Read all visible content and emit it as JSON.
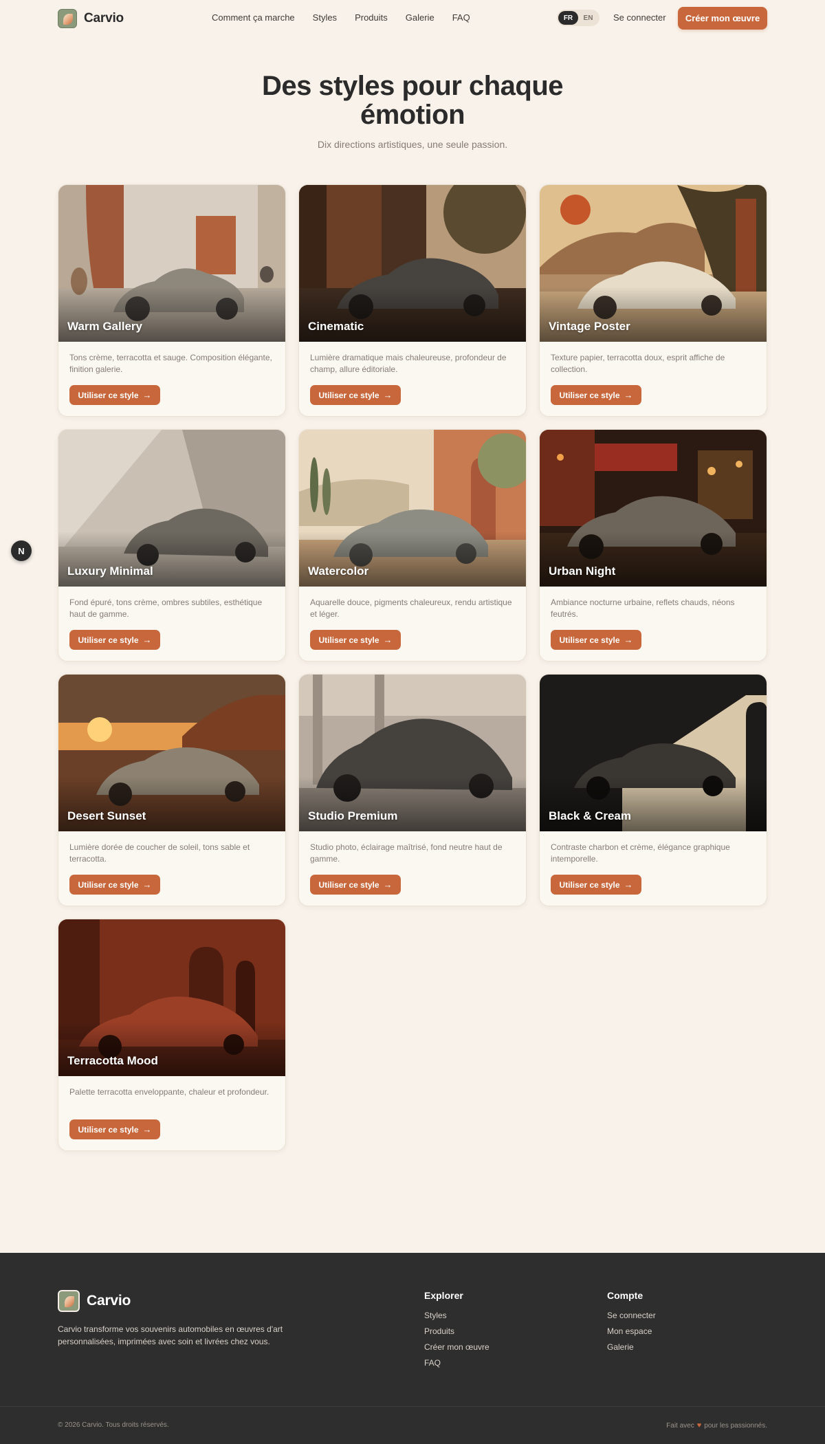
{
  "header": {
    "brand": "Carvio",
    "nav": [
      "Comment ça marche",
      "Styles",
      "Produits",
      "Galerie",
      "FAQ"
    ],
    "lang_active": "FR",
    "lang_other": "EN",
    "signin": "Se connecter",
    "cta": "Créer mon œuvre"
  },
  "hero": {
    "title": "Des styles pour chaque émotion",
    "subtitle": "Dix directions artistiques, une seule passion."
  },
  "button_label": "Utiliser ce style",
  "floating_badge": "N",
  "cards": [
    {
      "title": "Warm Gallery",
      "desc": "Tons crème, terracotta et sauge. Composition élégante, finition galerie."
    },
    {
      "title": "Cinematic",
      "desc": "Lumière dramatique mais chaleureuse, profondeur de champ, allure éditoriale."
    },
    {
      "title": "Vintage Poster",
      "desc": "Texture papier, terracotta doux, esprit affiche de collection."
    },
    {
      "title": "Luxury Minimal",
      "desc": "Fond épuré, tons crème, ombres subtiles, esthétique haut de gamme."
    },
    {
      "title": "Watercolor",
      "desc": "Aquarelle douce, pigments chaleureux, rendu artistique et léger."
    },
    {
      "title": "Urban Night",
      "desc": "Ambiance nocturne urbaine, reflets chauds, néons feutrés."
    },
    {
      "title": "Desert Sunset",
      "desc": "Lumière dorée de coucher de soleil, tons sable et terracotta."
    },
    {
      "title": "Studio Premium",
      "desc": "Studio photo, éclairage maîtrisé, fond neutre haut de gamme."
    },
    {
      "title": "Black & Cream",
      "desc": "Contraste charbon et crème, élégance graphique intemporelle."
    },
    {
      "title": "Terracotta Mood",
      "desc": "Palette terracotta enveloppante, chaleur et profondeur."
    }
  ],
  "footer": {
    "brand": "Carvio",
    "description": "Carvio transforme vos souvenirs automobiles en œuvres d'art personnalisées, imprimées avec soin et livrées chez vous.",
    "explore_title": "Explorer",
    "explore_links": [
      "Styles",
      "Produits",
      "Créer mon œuvre",
      "FAQ"
    ],
    "account_title": "Compte",
    "account_links": [
      "Se connecter",
      "Mon espace",
      "Galerie"
    ],
    "copyright": "© 2026 Carvio. Tous droits réservés.",
    "made_prefix": "Fait avec",
    "made_suffix": "pour les passionnés."
  },
  "colors": {
    "accent": "#c8673b",
    "background": "#f8f2ea",
    "footer": "#2e2e2e",
    "text": "#2b2b2b",
    "muted": "#857d74"
  },
  "icons": {
    "arrow": "arrow-right-icon",
    "heart": "heart-icon",
    "logo": "leaf-logo-icon"
  }
}
